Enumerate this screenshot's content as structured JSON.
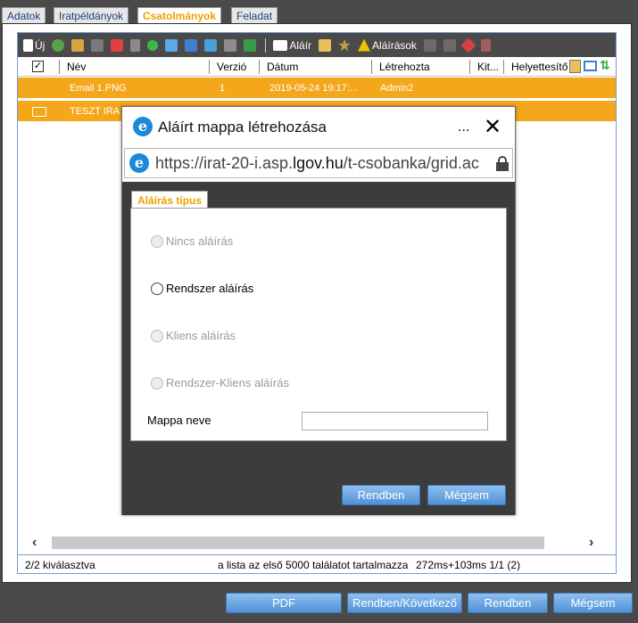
{
  "tabs": [
    {
      "label": "Adatok"
    },
    {
      "label": "Iratpéldányok"
    },
    {
      "label": "Csatolmányok"
    },
    {
      "label": "Feladat"
    }
  ],
  "toolbar": {
    "new_label": "Új",
    "sign_label": "Aláír",
    "signatures_label": "Aláírások"
  },
  "grid": {
    "headers": {
      "name": "Név",
      "version": "Verzió",
      "date": "Dátum",
      "created_by": "Létrehozta",
      "kit": "Kit...",
      "substitute": "Helyettesítő"
    },
    "rows": [
      {
        "name": "Email 1.PNG",
        "version": "1",
        "date": "2019-05-24 19:17:...",
        "created_by": "Admin2"
      },
      {
        "name": "TESZT IRA"
      }
    ]
  },
  "status": {
    "selected": "2/2 kiválasztva",
    "info": "a lista az első 5000 találatot tartalmazza",
    "timing": "272ms+103ms 1/1 (2)"
  },
  "modal": {
    "title": "Aláírt mappa létrehozása",
    "more": "...",
    "url_prefix": "https://irat-20-i.asp.",
    "url_domain": "lgov.hu",
    "url_suffix": "/t-csobanka/grid.ac",
    "tab_label": "Aláírás típus",
    "options": [
      {
        "label": "Nincs aláírás",
        "enabled": false
      },
      {
        "label": "Rendszer aláírás",
        "enabled": true
      },
      {
        "label": "Kliens aláírás",
        "enabled": false
      },
      {
        "label": "Rendszer-Kliens aláírás",
        "enabled": false
      }
    ],
    "folder_name_label": "Mappa neve",
    "folder_name_value": "",
    "ok_label": "Rendben",
    "cancel_label": "Mégsem"
  },
  "bottom_buttons": {
    "pdf": "PDF",
    "ok_next": "Rendben/Következő",
    "ok": "Rendben",
    "cancel": "Mégsem"
  },
  "colors": {
    "accent": "#f4a71b",
    "button": "#5b9be0",
    "dark": "#4a4a4a"
  }
}
